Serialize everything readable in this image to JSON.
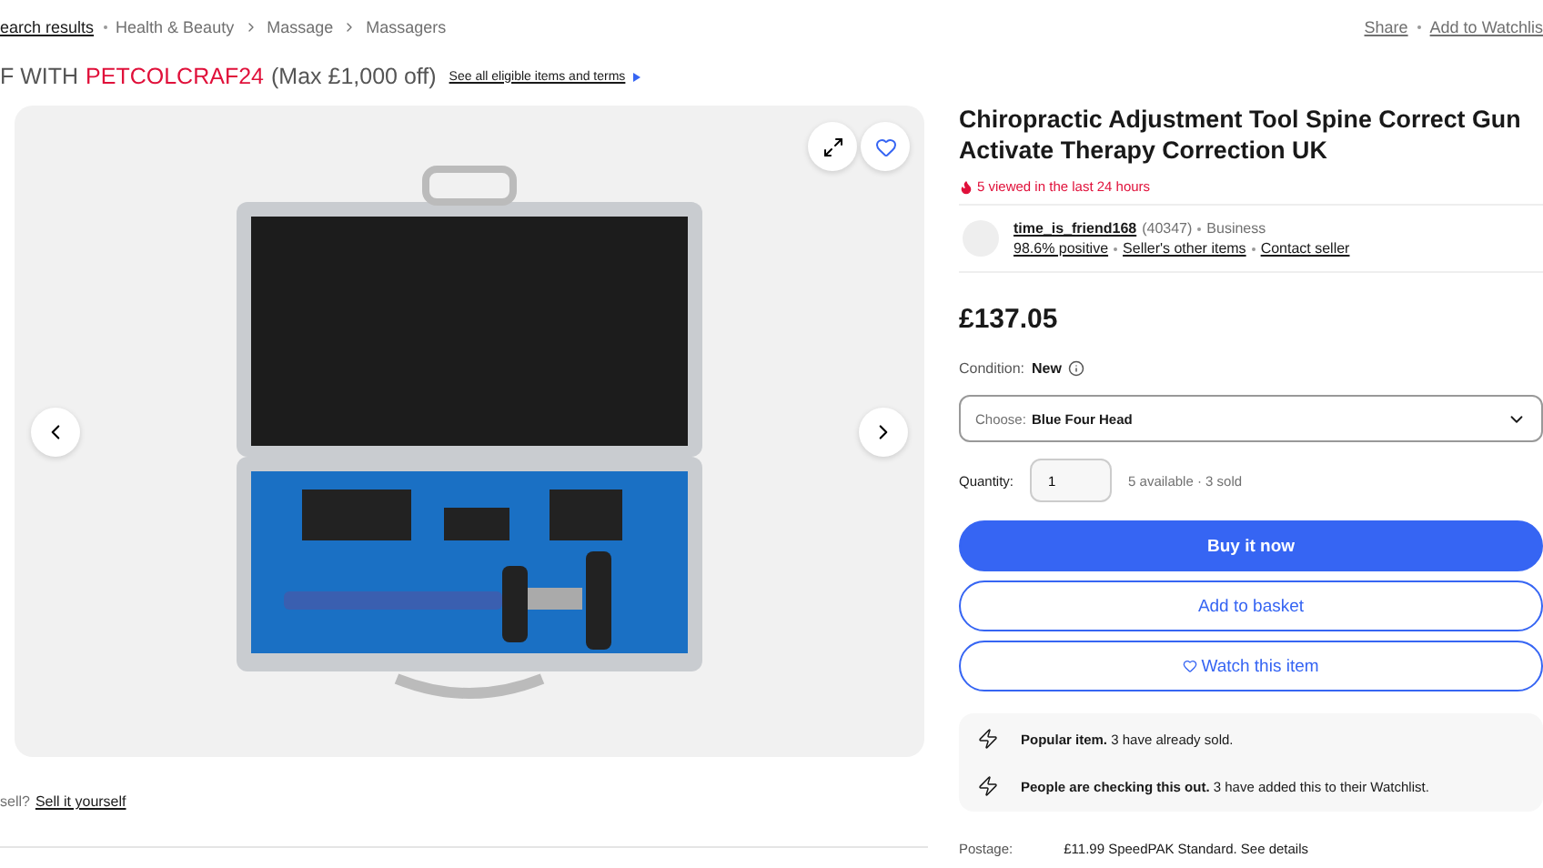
{
  "breadcrumb": {
    "items": [
      "earch results",
      "Health & Beauty",
      "Massage",
      "Massagers"
    ],
    "actions": [
      "Share",
      "Add to Watchlis"
    ]
  },
  "promo": {
    "prefix": "F WITH",
    "code": "PETCOLCRAF24",
    "suffix": "(Max £1,000 off)",
    "link": "See all eligible items and terms"
  },
  "gallery": {
    "sell_prompt": "sell?",
    "sell_link": "Sell it yourself"
  },
  "product": {
    "title": "Chiropractic Adjustment Tool Spine Correct Gun Activate Therapy Correction UK",
    "views": "5 viewed in the last 24 hours",
    "seller": {
      "name": "time_is_friend168",
      "feedback_count": "(40347)",
      "type": "Business",
      "positive": "98.6% positive",
      "other_items": "Seller's other items",
      "contact": "Contact seller"
    },
    "price": "£137.05",
    "condition_label": "Condition:",
    "condition": "New",
    "variant": {
      "label": "Choose:",
      "value": "Blue Four Head"
    },
    "quantity": {
      "label": "Quantity:",
      "value": "1",
      "availability": "5 available · 3 sold"
    },
    "buttons": [
      {
        "label": "Buy it now",
        "kind": "primary"
      },
      {
        "label": "Add to basket",
        "kind": "secondary"
      },
      {
        "label": "Watch this item",
        "kind": "watch"
      }
    ],
    "highlights": [
      {
        "bold": "Popular item.",
        "text": "3 have already sold."
      },
      {
        "bold": "People are checking this out.",
        "text": "3 have added this to their Watchlist."
      }
    ],
    "postage": {
      "label": "Postage:",
      "value": "£11.99 SpeedPAK Standard. See details"
    }
  }
}
